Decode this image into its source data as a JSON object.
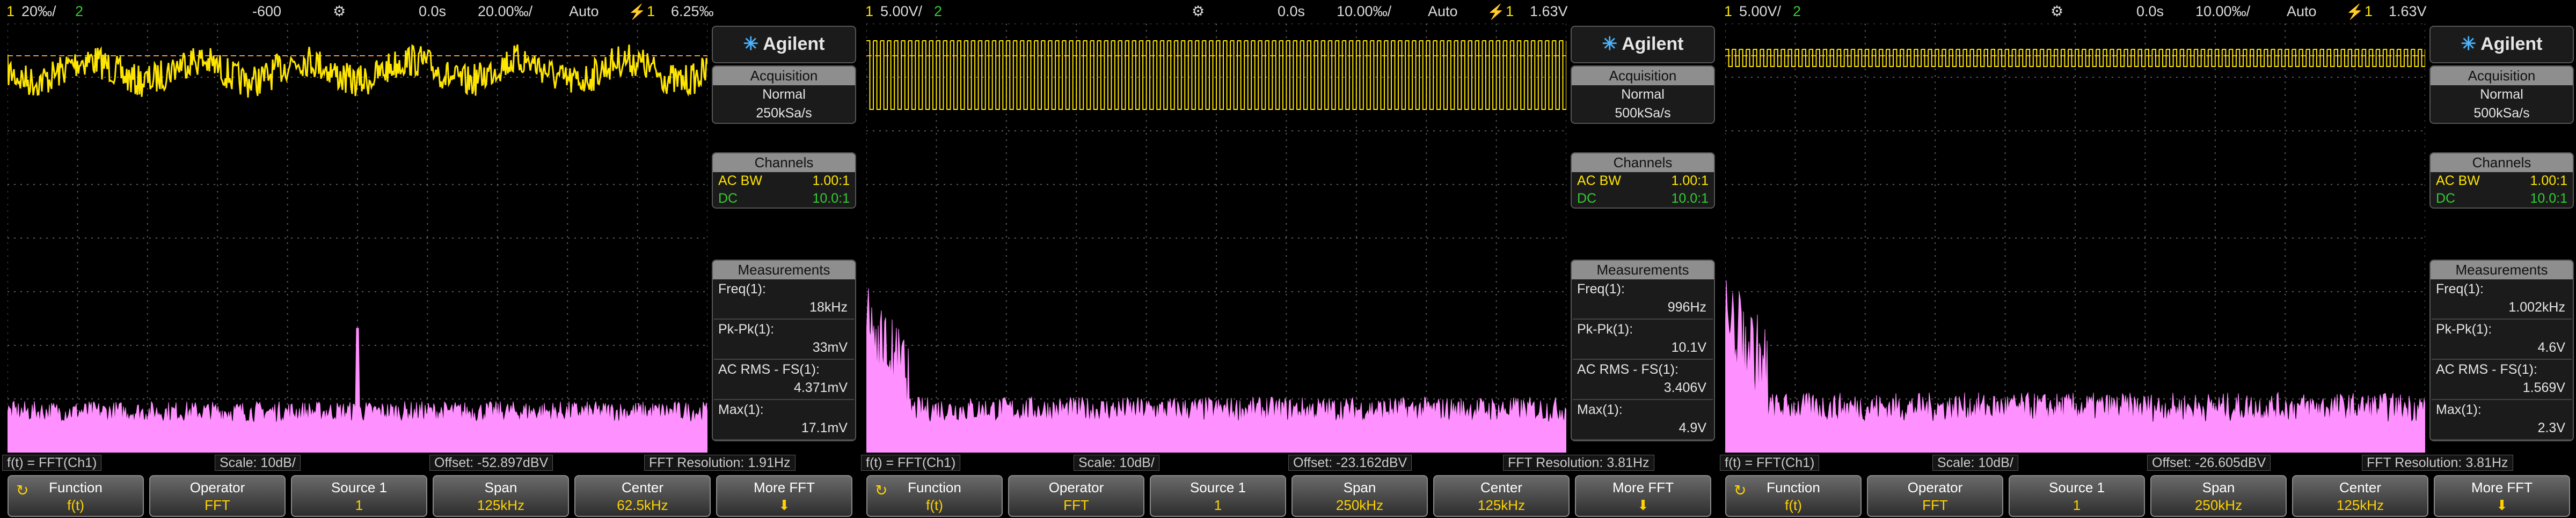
{
  "colors": {
    "ch1": "#ffe600",
    "ch2": "#33cc33",
    "fft": "#ff90ff",
    "grid": "#5a5a5a",
    "trig": "#ff9a2a"
  },
  "brand": "Agilent",
  "scopes": [
    {
      "top": {
        "ch1": "20 ɵ8/",
        "ch1_raw": "20‰/",
        "ch2": "2",
        "marker": "-600",
        "time": "0.0s",
        "tdiv": "20.00‰/",
        "mode": "Auto",
        "trig_icon": "⚡",
        "trig_ch": "1",
        "trig_level": "6.25‰"
      },
      "acq": {
        "title": "Acquisition",
        "mode": "Normal",
        "rate": "250kSa/s"
      },
      "channels": {
        "title": "Channels",
        "rows": [
          {
            "k": "AC BW",
            "v": "1.00:1",
            "c": "#ffe600"
          },
          {
            "k": "DC",
            "v": "10.0:1",
            "c": "#33cc33"
          }
        ]
      },
      "meas": {
        "title": "Measurements",
        "items": [
          {
            "n": "Freq(1):",
            "v": "18kHz"
          },
          {
            "n": "Pk-Pk(1):",
            "v": "33mV"
          },
          {
            "n": "AC RMS - FS(1):",
            "v": "4.371mV"
          },
          {
            "n": "Max(1):",
            "v": "17.1mV"
          }
        ]
      },
      "status": [
        "f(t) = FFT(Ch1)",
        "Scale: 10dB/",
        "Offset: -52.897dBV",
        "FFT Resolution: 1.91Hz"
      ],
      "keys": [
        {
          "t": "Function",
          "v": "f(t)"
        },
        {
          "t": "Operator",
          "v": "FFT"
        },
        {
          "t": "Source 1",
          "v": "1"
        },
        {
          "t": "Span",
          "v": "125kHz"
        },
        {
          "t": "Center",
          "v": "62.5kHz"
        },
        {
          "t": "More FFT",
          "v": "⬇"
        }
      ],
      "wave": {
        "kind": "noise",
        "center": 0.11,
        "amp": 0.038,
        "ripple": 0.025
      },
      "fft": {
        "base": 0.93,
        "height": 0.05,
        "spike_pos": 0.5,
        "spike_h": 0.22
      }
    },
    {
      "top": {
        "ch1": "5.00V/",
        "ch2": "2",
        "marker": "",
        "time": "0.0s",
        "tdiv": "10.00‰/",
        "mode": "Auto",
        "trig_icon": "⚡",
        "trig_ch": "1",
        "trig_level": "1.63V"
      },
      "acq": {
        "title": "Acquisition",
        "mode": "Normal",
        "rate": "500kSa/s"
      },
      "channels": {
        "title": "Channels",
        "rows": [
          {
            "k": "AC BW",
            "v": "1.00:1",
            "c": "#ffe600"
          },
          {
            "k": "DC",
            "v": "10.0:1",
            "c": "#33cc33"
          }
        ]
      },
      "meas": {
        "title": "Measurements",
        "items": [
          {
            "n": "Freq(1):",
            "v": "996Hz"
          },
          {
            "n": "Pk-Pk(1):",
            "v": "10.1V"
          },
          {
            "n": "AC RMS - FS(1):",
            "v": "3.406V"
          },
          {
            "n": "Max(1):",
            "v": "4.9V"
          }
        ]
      },
      "status": [
        "f(t) = FFT(Ch1)",
        "Scale: 10dB/",
        "Offset: -23.162dBV",
        "FFT Resolution: 3.81Hz"
      ],
      "keys": [
        {
          "t": "Function",
          "v": "f(t)"
        },
        {
          "t": "Operator",
          "v": "FFT"
        },
        {
          "t": "Source 1",
          "v": "1"
        },
        {
          "t": "Span",
          "v": "250kHz"
        },
        {
          "t": "Center",
          "v": "125kHz"
        },
        {
          "t": "More FFT",
          "v": "⬇"
        }
      ],
      "wave": {
        "kind": "square",
        "top": 0.04,
        "bot": 0.2,
        "cycles": 100
      },
      "fft": {
        "base": 0.93,
        "height": 0.06,
        "spike_pos": 0.005,
        "spike_h": 0.9
      }
    },
    {
      "top": {
        "ch1": "5.00V/",
        "ch2": "2",
        "marker": "",
        "time": "0.0s",
        "tdiv": "10.00‰/",
        "mode": "Auto",
        "trig_icon": "⚡",
        "trig_ch": "1",
        "trig_level": "1.63V"
      },
      "acq": {
        "title": "Acquisition",
        "mode": "Normal",
        "rate": "500kSa/s"
      },
      "channels": {
        "title": "Channels",
        "rows": [
          {
            "k": "AC BW",
            "v": "1.00:1",
            "c": "#ffe600"
          },
          {
            "k": "DC",
            "v": "10.0:1",
            "c": "#33cc33"
          }
        ]
      },
      "meas": {
        "title": "Measurements",
        "items": [
          {
            "n": "Freq(1):",
            "v": "1.002kHz"
          },
          {
            "n": "Pk-Pk(1):",
            "v": "4.6V"
          },
          {
            "n": "AC RMS - FS(1):",
            "v": "1.569V"
          },
          {
            "n": "Max(1):",
            "v": "2.3V"
          }
        ]
      },
      "status": [
        "f(t) = FFT(Ch1)",
        "Scale: 10dB/",
        "Offset: -26.605dBV",
        "FFT Resolution: 3.81Hz"
      ],
      "keys": [
        {
          "t": "Function",
          "v": "f(t)"
        },
        {
          "t": "Operator",
          "v": "FFT"
        },
        {
          "t": "Source 1",
          "v": "1"
        },
        {
          "t": "Span",
          "v": "250kHz"
        },
        {
          "t": "Center",
          "v": "125kHz"
        },
        {
          "t": "More FFT",
          "v": "⬇"
        }
      ],
      "wave": {
        "kind": "square",
        "top": 0.06,
        "bot": 0.1,
        "cycles": 100
      },
      "fft": {
        "base": 0.93,
        "height": 0.07,
        "spike_pos": 0.01,
        "spike_h": 0.3
      }
    }
  ]
}
